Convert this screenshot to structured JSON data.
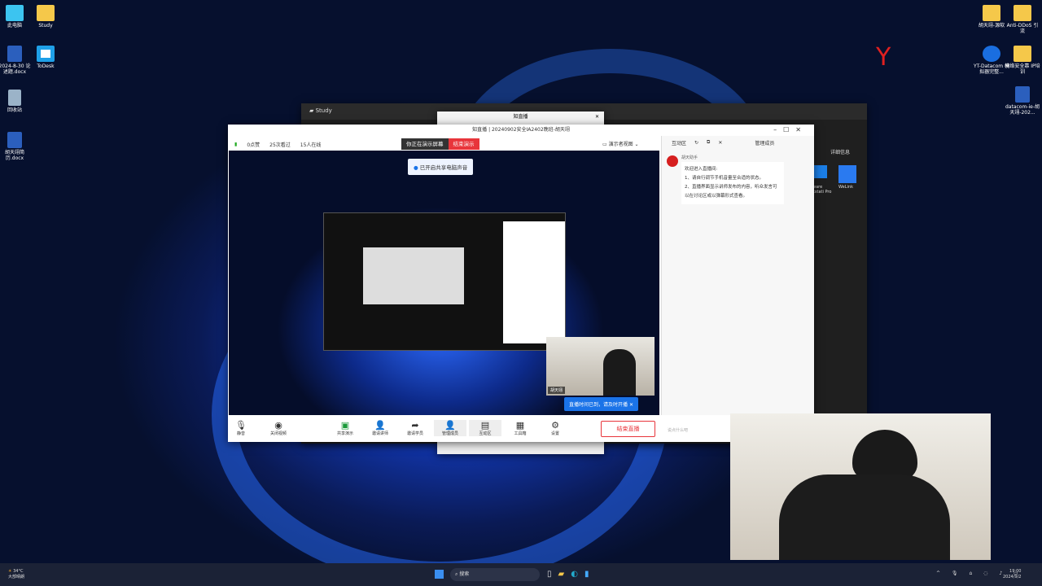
{
  "desktop": {
    "left_icons": [
      {
        "label": "此电脑",
        "icon": "computer-icon"
      },
      {
        "label": "Study",
        "icon": "folder-icon"
      },
      {
        "label": "2024-8-30 论述题.docx",
        "icon": "word-icon"
      },
      {
        "label": "ToDesk",
        "icon": "todesk-icon"
      },
      {
        "label": "回收站",
        "icon": "recycle-bin-icon"
      },
      {
        "label": "胡天翊简历.docx",
        "icon": "word-icon"
      }
    ],
    "right_icons": [
      {
        "label": "胡天翊-源软",
        "icon": "folder-icon"
      },
      {
        "label": "Anti-DDoS 引流",
        "icon": "folder-icon"
      },
      {
        "label": "YT-Datacom 模拟器完整...",
        "icon": "zip-icon"
      },
      {
        "label": "网络安全靠 IP培训",
        "icon": "folder-icon"
      },
      {
        "label": "datacom-ie-胡天翊-202...",
        "icon": "word-icon"
      }
    ]
  },
  "study_window": {
    "title": "Study",
    "partial_labels": [
      "详细信息",
      "ware kstati Pro",
      "WeLink"
    ]
  },
  "small_dialog": {
    "title": "知直播"
  },
  "live": {
    "title": "知直播 | 20240902安全IA2402晚班-胡天翊",
    "stats": {
      "likes": "0点赞",
      "views": "25次看过",
      "online": "15人在线"
    },
    "presenting": "你正在演示屏幕",
    "stop_presenting": "结束演示",
    "view_mode": "演示者视图",
    "share_tip": "已开启共享电脑声音",
    "toast": "直播时间已到，请及时开播",
    "cam_name": "胡天翊",
    "panel_tabs": {
      "interact": "互动区",
      "members": "管理成员"
    },
    "chat": {
      "sender": "胡天助手",
      "lines": [
        "欢迎进入直播间:",
        "1、请自行调节手机音量至合适的状态。",
        "2、直播界面显示讲师发布的内容，听众发言可以在讨论区或以弹幕形式查看。"
      ]
    },
    "chat_placeholder": "说点什么吧",
    "toolbar": [
      {
        "label": "静音",
        "icon": "microphone-icon"
      },
      {
        "label": "关闭视频",
        "icon": "camera-icon"
      },
      {
        "label": "共享演示",
        "icon": "share-screen-icon"
      },
      {
        "label": "邀请讲师",
        "icon": "invite-lecturer-icon"
      },
      {
        "label": "邀请学员",
        "icon": "invite-student-icon"
      },
      {
        "label": "管理成员",
        "icon": "members-icon"
      },
      {
        "label": "互动区",
        "icon": "chat-icon"
      },
      {
        "label": "工具箱",
        "icon": "toolbox-icon"
      },
      {
        "label": "设置",
        "icon": "settings-icon"
      }
    ],
    "end_live": "结束直播"
  },
  "taskbar": {
    "weather_temp": "34°C",
    "weather_text": "大部晴朗",
    "search": "搜索",
    "time": "19:00",
    "date": "2024/9/2"
  },
  "colors": {
    "accent": "#1a73e8",
    "danger": "#e8353b"
  }
}
